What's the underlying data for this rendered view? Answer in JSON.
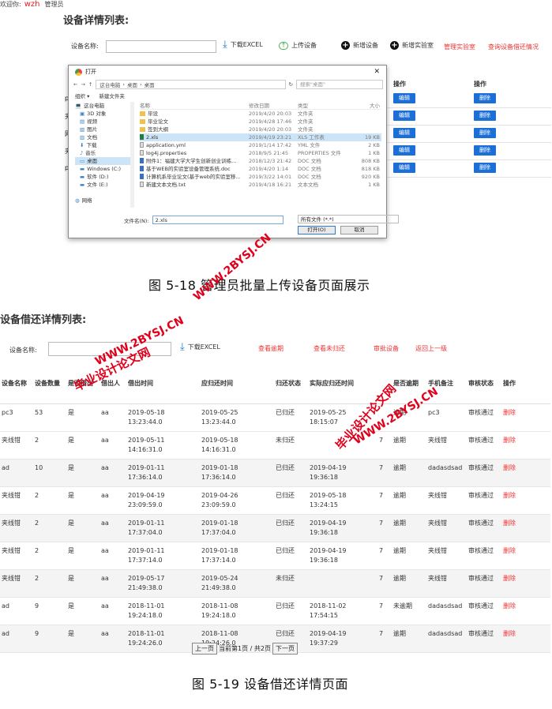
{
  "topbar": {
    "welcome": "欢迎你:",
    "user": "wzh",
    "role": "管理员"
  },
  "section1": {
    "title": "设备详情列表:",
    "name_label": "设备名称:",
    "download_excel": "下载EXCEL",
    "upload_device": "上传设备",
    "add_device": "新增设备",
    "add_lab": "新增实验室",
    "manage_lab": "管理实验室",
    "query_lend": "查询设备借还情况",
    "col_op1": "操作",
    "col_op2": "操作",
    "edit_label": "编辑",
    "delete_label": "删除",
    "left_fragments": [
      "p",
      "夹",
      "网",
      "夹",
      "p"
    ]
  },
  "dialog": {
    "title": "打开",
    "path": [
      "这台电脑",
      "桌面",
      "桌面"
    ],
    "search_placeholder": "搜索\"桌面\"",
    "organize": "组织 ▾",
    "new_folder": "新建文件夹",
    "tree": [
      "这台电脑",
      "3D 对象",
      "视频",
      "图片",
      "文档",
      "下载",
      "音乐",
      "桌面",
      "Windows (C:)",
      "软件 (D:)",
      "文件 (E:)",
      "",
      "网络"
    ],
    "headers": {
      "name": "名称",
      "date": "修改日期",
      "type": "类型",
      "size": "大小"
    },
    "files": [
      {
        "name": "毕设",
        "date": "2019/4/20 20:03",
        "type": "文件夹",
        "size": "",
        "icon": "folder"
      },
      {
        "name": "毕业论文",
        "date": "2019/4/28 17:46",
        "type": "文件夹",
        "size": "",
        "icon": "folder"
      },
      {
        "name": "签到大纲",
        "date": "2019/4/20 20:03",
        "type": "文件夹",
        "size": "",
        "icon": "folder"
      },
      {
        "name": "2.xls",
        "date": "2019/4/19 23:21",
        "type": "XLS 工作表",
        "size": "19 KB",
        "icon": "xls"
      },
      {
        "name": "application.yml",
        "date": "2019/1/14 17:42",
        "type": "YML 文件",
        "size": "2 KB",
        "icon": "txt"
      },
      {
        "name": "log4j.properties",
        "date": "2018/9/5 21:45",
        "type": "PROPERTIES 文件",
        "size": "1 KB",
        "icon": "txt"
      },
      {
        "name": "附件1：福建大学大学生创新创业训练...",
        "date": "2018/12/3 21:42",
        "type": "DOC 文档",
        "size": "808 KB",
        "icon": "doc"
      },
      {
        "name": "基于WEB的实验室设备管理系统.doc",
        "date": "2019/4/20 1:14",
        "type": "DOC 文档",
        "size": "818 KB",
        "icon": "doc"
      },
      {
        "name": "计算机系毕业论文(基于web的实验室移...",
        "date": "2019/3/22 14:01",
        "type": "DOC 文档",
        "size": "920 KB",
        "icon": "doc"
      },
      {
        "name": "新建文本文档.txt",
        "date": "2019/4/18 16:21",
        "type": "文本文档",
        "size": "1 KB",
        "icon": "txt"
      }
    ],
    "filename_label": "文件名(N):",
    "filename_value": "2.xls",
    "filetype_value": "所有文件 (*.*)",
    "open_label": "打开(O)",
    "cancel_label": "取消"
  },
  "captions": {
    "fig18": "图 5-18 管理员批量上传设备页面展示",
    "fig19": "图 5-19 设备借还详情页面"
  },
  "section2": {
    "title": "设备借还详情列表:",
    "name_label": "设备名称:",
    "download_excel": "下载EXCEL",
    "view_overdue": "查看逾期",
    "view_unreturned": "查看未归还",
    "audit_devices": "审批设备",
    "back": "返回上一级",
    "headers": [
      "设备名称",
      "设备数量",
      "是否借出",
      "借出人",
      "借出时间",
      "应归还时间",
      "归还状态",
      "实际应归还时间",
      "",
      "是否逾期",
      "手机备注",
      "审核状态",
      "操作"
    ],
    "rows": [
      [
        "pc3",
        "53",
        "是",
        "aa",
        "2019-05-18 13:23:44.0",
        "2019-05-25 13:23:44.0",
        "已归还",
        "2019-05-25 18:15:07",
        "",
        "逾期",
        "pc3",
        "审核通过",
        "删除"
      ],
      [
        "夹线钳",
        "2",
        "是",
        "aa",
        "2019-05-11 14:16:31.0",
        "2019-05-18 14:16:31.0",
        "未归还",
        "",
        "7",
        "逾期",
        "夹线钳",
        "审核通过",
        "删除"
      ],
      [
        "ad",
        "10",
        "是",
        "aa",
        "2019-01-11 17:36:14.0",
        "2019-01-18 17:36:14.0",
        "已归还",
        "2019-04-19 19:36:18",
        "7",
        "逾期",
        "dadasdsad",
        "审核通过",
        "删除"
      ],
      [
        "夹线钳",
        "2",
        "是",
        "aa",
        "2019-04-19 23:09:59.0",
        "2019-04-26 23:09:59.0",
        "已归还",
        "2019-05-18 13:24:15",
        "7",
        "逾期",
        "夹线钳",
        "审核通过",
        "删除"
      ],
      [
        "夹线钳",
        "2",
        "是",
        "aa",
        "2019-01-11 17:37:04.0",
        "2019-01-18 17:37:04.0",
        "已归还",
        "2019-04-19 19:36:18",
        "7",
        "逾期",
        "夹线钳",
        "审核通过",
        "删除"
      ],
      [
        "夹线钳",
        "2",
        "是",
        "aa",
        "2019-01-11 17:37:14.0",
        "2019-01-18 17:37:14.0",
        "已归还",
        "2019-04-19 19:36:18",
        "7",
        "逾期",
        "夹线钳",
        "审核通过",
        "删除"
      ],
      [
        "夹线钳",
        "2",
        "是",
        "aa",
        "2019-05-17 21:49:38.0",
        "2019-05-24 21:49:38.0",
        "未归还",
        "",
        "7",
        "逾期",
        "夹线钳",
        "审核通过",
        "删除"
      ],
      [
        "ad",
        "9",
        "是",
        "aa",
        "2018-11-01 19:24:18.0",
        "2018-11-08 19:24:18.0",
        "已归还",
        "2018-11-02 17:54:15",
        "7",
        "未逾期",
        "dadasdsad",
        "审核通过",
        "删除"
      ],
      [
        "ad",
        "9",
        "是",
        "aa",
        "2018-11-01 19:24:26.0",
        "2018-11-08 19:24:26.0",
        "已归还",
        "2019-04-19 19:37:29",
        "7",
        "逾期",
        "dadasdsad",
        "审核通过",
        "删除"
      ]
    ],
    "pager": {
      "prev": "上一页",
      "info": "当前第1页 / 共2页",
      "next": "下一页"
    }
  },
  "watermarks": {
    "url": "WWW.2BYSJ.CN",
    "cn": "毕业设计论文网"
  }
}
